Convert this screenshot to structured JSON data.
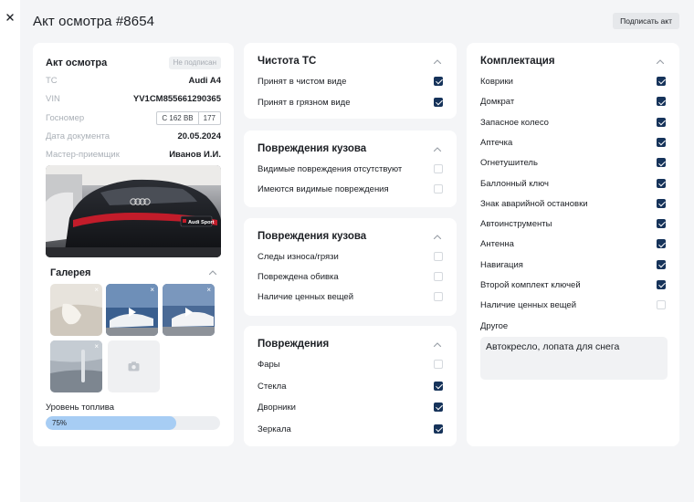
{
  "page": {
    "title": "Акт осмотра #8654",
    "sign_button": "Подписать акт"
  },
  "act": {
    "title": "Акт осмотра",
    "status": "Не подписан",
    "rows": {
      "vehicle": {
        "label": "ТС",
        "value": "Audi A4"
      },
      "vin": {
        "label": "VIN",
        "value": "YV1CM855661290365"
      },
      "plate": {
        "label": "Госномер",
        "number": "С 162 ВВ",
        "region": "177"
      },
      "date": {
        "label": "Дата документа",
        "value": "20.05.2024"
      },
      "master": {
        "label": "Мастер-приемщик",
        "value": "Иванов И.И."
      }
    },
    "photo_brand": "Audi Sport",
    "gallery": {
      "title": "Галерея",
      "remove_symbol": "×",
      "thumbs": [
        "photo",
        "video",
        "video",
        "photo"
      ]
    },
    "fuel": {
      "label": "Уровень топлива",
      "percent_text": "75%",
      "value": 0.75
    }
  },
  "cleanliness": {
    "title": "Чистота ТС",
    "items": [
      {
        "label": "Принят в чистом виде",
        "checked": true
      },
      {
        "label": "Принят в грязном виде",
        "checked": true
      }
    ]
  },
  "body_damage_1": {
    "title": "Повреждения кузова",
    "items": [
      {
        "label": "Видимые повреждения отсутствуют",
        "checked": false
      },
      {
        "label": "Имеются видимые повреждения",
        "checked": false
      }
    ]
  },
  "body_damage_2": {
    "title": "Повреждения кузова",
    "items": [
      {
        "label": "Следы износа/грязи",
        "checked": false
      },
      {
        "label": "Повреждена обивка",
        "checked": false
      },
      {
        "label": "Наличие ценных вещей",
        "checked": false
      }
    ]
  },
  "damages": {
    "title": "Повреждения",
    "items": [
      {
        "label": "Фары",
        "checked": false
      },
      {
        "label": "Стекла",
        "checked": true
      },
      {
        "label": "Дворники",
        "checked": true
      },
      {
        "label": "Зеркала",
        "checked": true
      }
    ]
  },
  "equipment": {
    "title": "Комплектация",
    "items": [
      {
        "label": "Коврики",
        "checked": true
      },
      {
        "label": "Домкрат",
        "checked": true
      },
      {
        "label": "Запасное колесо",
        "checked": true
      },
      {
        "label": "Аптечка",
        "checked": true
      },
      {
        "label": "Огнетушитель",
        "checked": true
      },
      {
        "label": "Баллонный ключ",
        "checked": true
      },
      {
        "label": "Знак аварийной остановки",
        "checked": true
      },
      {
        "label": "Автоинструменты",
        "checked": true
      },
      {
        "label": "Антенна",
        "checked": true
      },
      {
        "label": "Навигация",
        "checked": true
      },
      {
        "label": "Второй комплект ключей",
        "checked": true
      },
      {
        "label": "Наличие ценных вещей",
        "checked": false
      }
    ],
    "other_label": "Другое",
    "other_value": "Автокресло, лопата для снега"
  },
  "colors": {
    "accent": "#16335a",
    "fuel_fill": "#a7cdf4",
    "page_bg": "#f4f5f7"
  }
}
